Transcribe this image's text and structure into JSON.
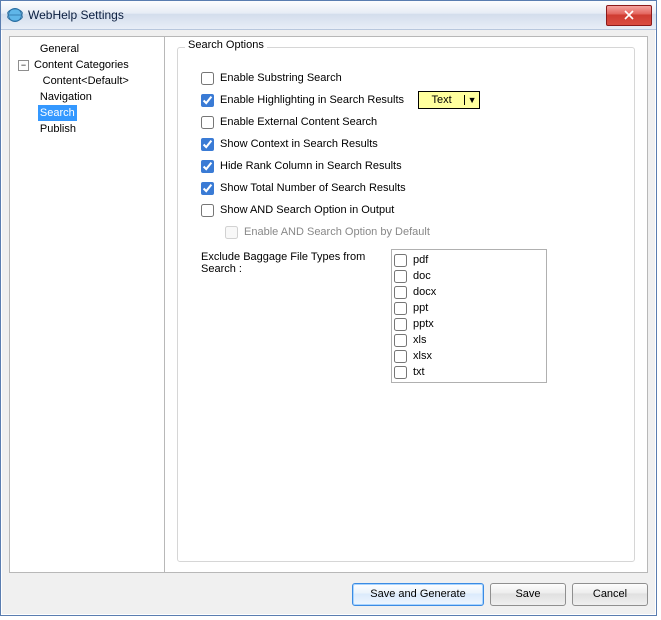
{
  "window": {
    "title": "WebHelp Settings"
  },
  "tree": {
    "general": "General",
    "contentCategories": "Content Categories",
    "contentDefault": "Content<Default>",
    "navigation": "Navigation",
    "search": "Search",
    "publish": "Publish"
  },
  "group": {
    "legend": "Search Options",
    "opt_substring": "Enable Substring Search",
    "opt_highlight": "Enable Highlighting in Search Results",
    "highlight_value": "Text",
    "opt_external": "Enable External Content Search",
    "opt_context": "Show Context in Search Results",
    "opt_hiderank": "Hide Rank Column in Search Results",
    "opt_total": "Show Total Number of Search Results",
    "opt_andoutput": "Show AND Search Option in Output",
    "opt_anddefault": "Enable AND Search Option by Default",
    "exclude_label": "Exclude Baggage File Types from Search :",
    "ft_pdf": "pdf",
    "ft_doc": "doc",
    "ft_docx": "docx",
    "ft_ppt": "ppt",
    "ft_pptx": "pptx",
    "ft_xls": "xls",
    "ft_xlsx": "xlsx",
    "ft_txt": "txt"
  },
  "buttons": {
    "saveGenerate": "Save and Generate",
    "save": "Save",
    "cancel": "Cancel"
  }
}
